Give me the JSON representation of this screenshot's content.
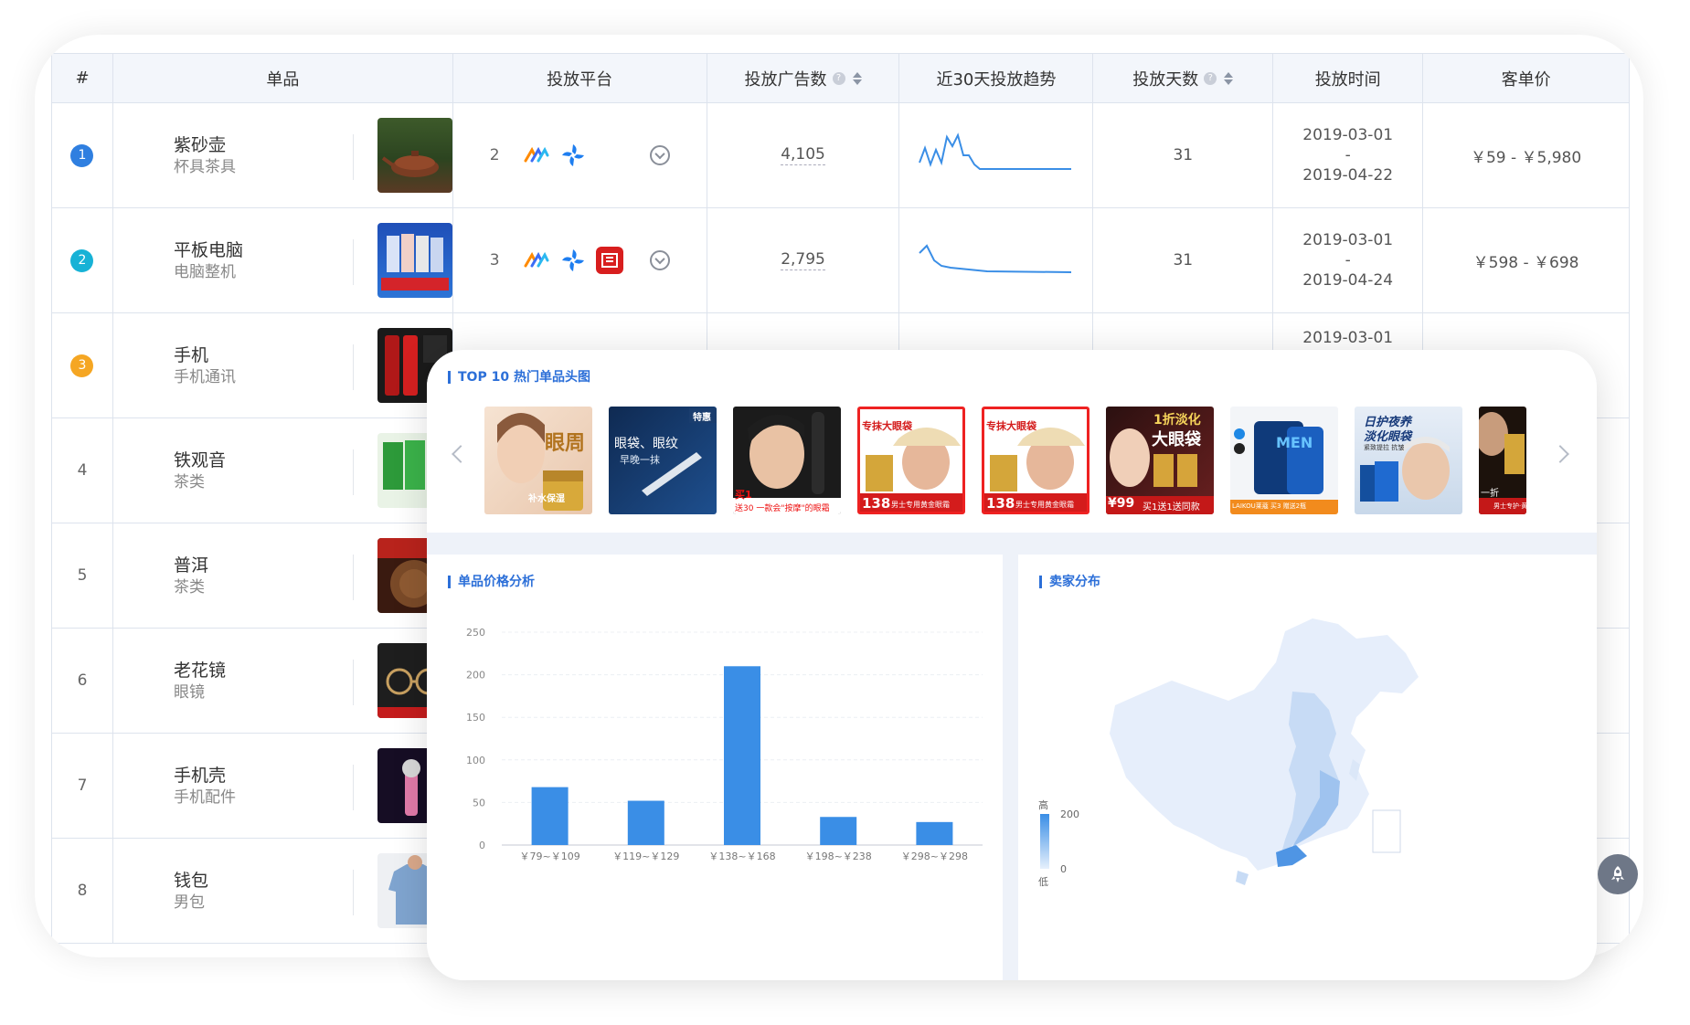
{
  "table": {
    "headers": {
      "rank": "#",
      "product": "单品",
      "platform": "投放平台",
      "ad_count": "投放广告数",
      "trend": "近30天投放趋势",
      "days": "投放天数",
      "period": "投放时间",
      "price": "客单价"
    },
    "rows": [
      {
        "rank": "1",
        "name": "紫砂壶",
        "category": "杯具茶具",
        "platform_count": "2",
        "ads": "4,105",
        "days": "31",
        "date_from": "2019-03-01",
        "date_sep": "-",
        "date_to": "2019-04-22",
        "price": "￥59 - ￥5,980"
      },
      {
        "rank": "2",
        "name": "平板电脑",
        "category": "电脑整机",
        "platform_count": "3",
        "ads": "2,795",
        "days": "31",
        "date_from": "2019-03-01",
        "date_sep": "-",
        "date_to": "2019-04-24",
        "price": "￥598 - ￥698"
      },
      {
        "rank": "3",
        "name": "手机",
        "category": "手机通讯",
        "date_from": "2019-03-01"
      },
      {
        "rank": "4",
        "name": "铁观音",
        "category": "茶类"
      },
      {
        "rank": "5",
        "name": "普洱",
        "category": "茶类"
      },
      {
        "rank": "6",
        "name": "老花镜",
        "category": "眼镜"
      },
      {
        "rank": "7",
        "name": "手机壳",
        "category": "手机配件"
      },
      {
        "rank": "8",
        "name": "钱包",
        "category": "男包"
      }
    ],
    "rank_colors": [
      "#2f7fe0",
      "#17b2d6",
      "#f5a623"
    ]
  },
  "top10": {
    "title": "TOP 10 热门单品头图",
    "ads": [
      {
        "text": "眼周",
        "sub": "补水保湿"
      },
      {
        "text": "眼袋、眼纹",
        "sub": "早晚一抹",
        "badge": "特惠"
      },
      {
        "text": "买1",
        "sub": "送30 一款会\"按摩\"的眼霜"
      },
      {
        "text": "专抹大眼袋",
        "price": "138",
        "sub": "男士专用黄金眼霜"
      },
      {
        "text": "专抹大眼袋",
        "price": "138",
        "sub": "男士专用黄金眼霜"
      },
      {
        "text": "1折淡化",
        "text2": "大眼袋",
        "price": "¥99",
        "sub": "买1送1送同款"
      },
      {
        "text": "MEN",
        "sub": "LAIKOU莱蔻 买3 赠送2瓶"
      },
      {
        "text": "日护夜养",
        "text2": "淡化眼袋",
        "sub": "紧致提拉 抗皱"
      },
      {
        "text": "一折",
        "sub": "男士专护·黄金"
      }
    ]
  },
  "price_chart": {
    "title": "单品价格分析"
  },
  "chart_data": {
    "type": "bar",
    "categories": [
      "￥79~￥109",
      "￥119~￥129",
      "￥138~￥168",
      "￥198~￥238",
      "￥298~￥298"
    ],
    "values": [
      68,
      52,
      210,
      33,
      27
    ],
    "ylim": [
      0,
      250
    ],
    "yticks": [
      "0",
      "50",
      "100",
      "150",
      "200",
      "250"
    ],
    "title": "",
    "xlabel": "",
    "ylabel": "",
    "color": "#3a8ee6",
    "grid": true
  },
  "seller": {
    "title": "卖家分布",
    "legend_high": "高",
    "legend_low": "低",
    "legend_max": "200",
    "legend_min": "0"
  },
  "icons": {
    "rocket": "rocket-icon",
    "chevron": "chevron-down-circle-icon"
  }
}
